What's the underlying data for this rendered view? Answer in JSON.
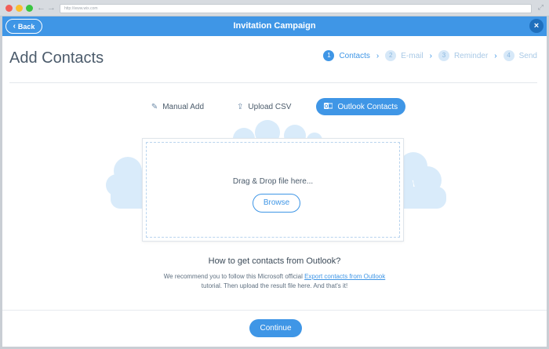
{
  "browser": {
    "url": "http://www.wix.com"
  },
  "header": {
    "back_label": "Back",
    "title": "Invitation Campaign",
    "close_glyph": "×"
  },
  "page": {
    "title": "Add Contacts"
  },
  "steps": [
    {
      "num": "1",
      "label": "Contacts",
      "active": true
    },
    {
      "num": "2",
      "label": "E-mail",
      "active": false
    },
    {
      "num": "3",
      "label": "Reminder",
      "active": false
    },
    {
      "num": "4",
      "label": "Send",
      "active": false
    }
  ],
  "tabs": [
    {
      "label": "Manual Add",
      "icon": "pencil-icon",
      "active": false
    },
    {
      "label": "Upload CSV",
      "icon": "upload-icon",
      "active": false
    },
    {
      "label": "Outlook Contacts",
      "icon": "outlook-icon",
      "active": true
    }
  ],
  "dropzone": {
    "text": "Drag & Drop file here...",
    "browse_label": "Browse"
  },
  "help": {
    "heading": "How to get contacts from Outlook?",
    "text_before": "We recommend you to follow this Microsoft official ",
    "link_text": "Export contacts from Outlook",
    "text_after": "tutorial. Then upload the result file here. And that's it!"
  },
  "footer": {
    "continue_label": "Continue"
  },
  "colors": {
    "accent": "#3f96e6",
    "cloud": "#d9ebfa"
  }
}
